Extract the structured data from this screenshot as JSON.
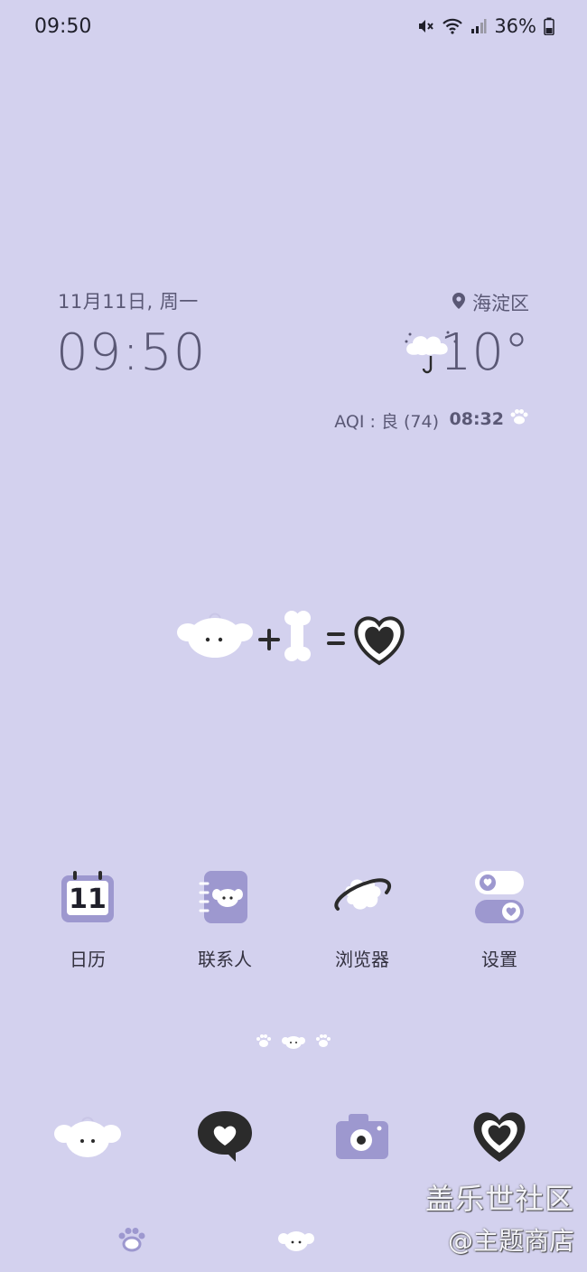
{
  "status_bar": {
    "time": "09:50",
    "battery": "36%"
  },
  "widget": {
    "date": "11月11日, 周一",
    "time": "09:50",
    "location": "海淀区",
    "temperature": "10°",
    "aqi": "AQI : 良 (74)",
    "sunrise_time": "08:32"
  },
  "apps": [
    {
      "label": "日历",
      "icon": "calendar-icon",
      "day": "11"
    },
    {
      "label": "联系人",
      "icon": "contacts-icon"
    },
    {
      "label": "浏览器",
      "icon": "browser-icon"
    },
    {
      "label": "设置",
      "icon": "settings-icon"
    }
  ],
  "dock": [
    {
      "icon": "puppy-icon"
    },
    {
      "icon": "message-heart-icon"
    },
    {
      "icon": "camera-icon"
    },
    {
      "icon": "heart-icon"
    }
  ],
  "watermark": {
    "line1": "盖乐世社区",
    "line2": "@主题商店"
  },
  "colors": {
    "background": "#d3d1ee",
    "accent": "#9d98cf",
    "ink": "#2b2b2b"
  }
}
